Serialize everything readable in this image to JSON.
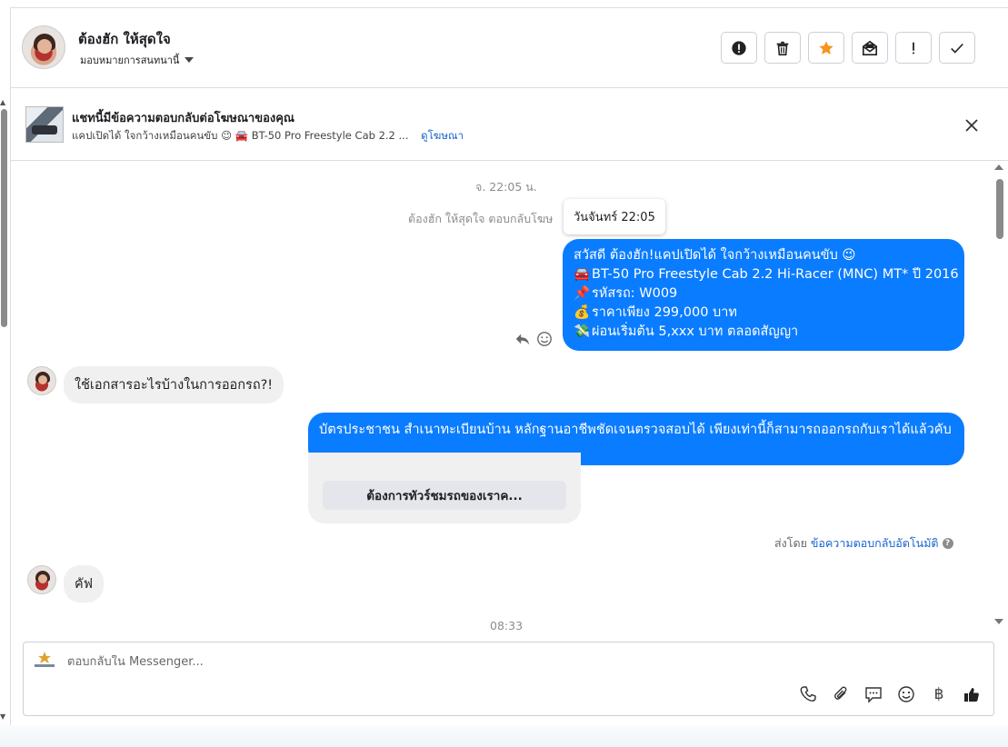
{
  "header": {
    "name": "ต้องฮัก ให้สุดใจ",
    "assign_label": "มอบหมายการสนทนานี้",
    "toolbar": [
      {
        "icon": "alert-circle-icon"
      },
      {
        "icon": "trash-icon"
      },
      {
        "icon": "star-icon"
      },
      {
        "icon": "mark-unread-icon"
      },
      {
        "icon": "exclamation-icon"
      },
      {
        "icon": "check-icon"
      }
    ]
  },
  "ad_banner": {
    "title": "แชทนี้มีข้อความตอบกลับต่อโฆษณาของคุณ",
    "subtitle": "แคปเปิดได้ ใจกว้างเหมือนคนขับ 😉 🚘 BT-50 Pro Freestyle Cab 2.2 ...",
    "link": "ดูโฆษณา"
  },
  "chat": {
    "timestamp_top": "จ. 22:05 น.",
    "system_note": "ต้องฮัก ให้สุดใจ ตอบกลับโฆษ",
    "tooltip": "วันจันทร์ 22:05",
    "outgoing_1": [
      {
        "emoji": "",
        "text": "สวัสดี ต้องฮัก!แคปเปิดได้ ใจกว้างเหมือนคนขับ 😉"
      },
      {
        "emoji": "🚘",
        "text": "BT-50 Pro Freestyle Cab 2.2 Hi-Racer (MNC) MT* ปี 2016"
      },
      {
        "emoji": "📌",
        "text": "รหัสรถ: W009"
      },
      {
        "emoji": "💰",
        "text": "ราคาเพียง 299,000 บาท"
      },
      {
        "emoji": "💸",
        "text": "ผ่อนเริ่มต้น 5,xxx บาท ตลอดสัญญา"
      }
    ],
    "incoming_1": "ใช้เอกสารอะไรบ้างในการออกรถ?!",
    "outgoing_2": "บัตรประชาชน สำเนาทะเบียนบ้าน หลักฐานอาชีพชัดเจนตรวจสอบได้ เพียงเท่านี้ก็สามารถออกรถกับเราได้แล้วคับ",
    "template_button": "ต้องการทัวร์ชมรถของเราค...",
    "sent_by_prefix": "ส่งโดย",
    "sent_by_link": "ข้อความตอบกลับอัตโนมัติ",
    "incoming_2": "คัฟ",
    "timestamp_bottom": "08:33"
  },
  "composer": {
    "placeholder": "ตอบกลับใน Messenger...",
    "icons": [
      "phone-icon",
      "paperclip-icon",
      "saved-reply-icon",
      "emoji-icon",
      "baht-icon",
      "thumbs-up-icon"
    ],
    "baht_symbol": "฿"
  },
  "colors": {
    "outgoing_bubble": "#0a7cff",
    "incoming_bubble": "#f0f0f0",
    "link": "#1763cf",
    "star": "#f7931e"
  }
}
